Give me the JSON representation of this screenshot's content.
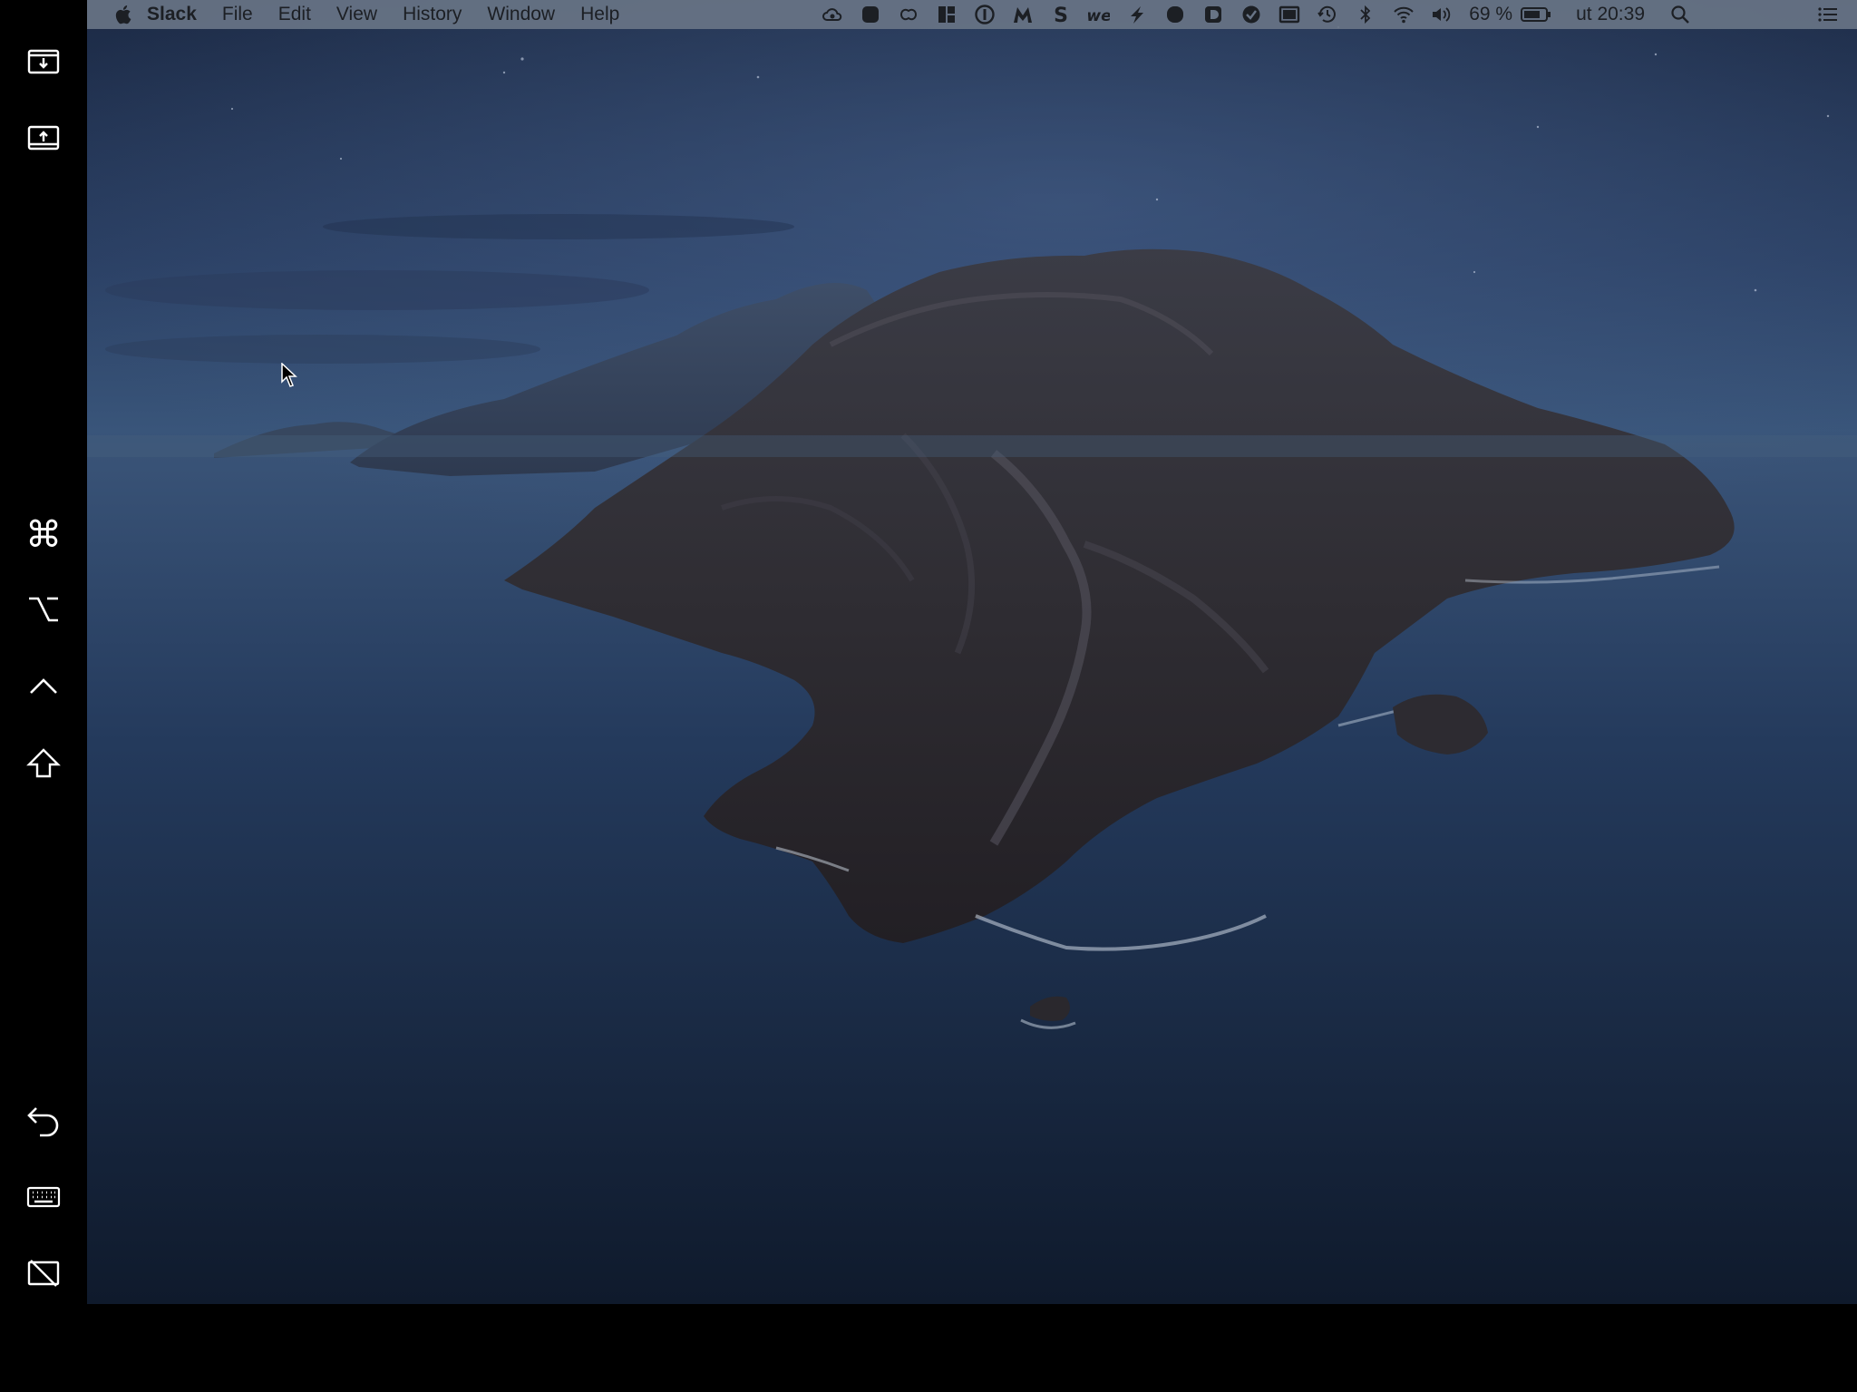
{
  "menubar": {
    "app_name": "Slack",
    "menus": [
      "File",
      "Edit",
      "View",
      "History",
      "Window",
      "Help"
    ],
    "battery": "69 %",
    "clock": "ut 20:39",
    "status_icons": [
      "creative-cloud-icon",
      "record-icon",
      "mindnode-icon",
      "magnet-icon",
      "1password-icon",
      "mailbutler-icon",
      "scrivener-icon",
      "wechat-icon",
      "spark-icon",
      "record-icon",
      "dropzone-icon",
      "things-icon",
      "display-icon",
      "time-machine-icon",
      "bluetooth-icon",
      "wifi-icon",
      "volume-icon"
    ]
  },
  "sidebar": {
    "buttons": [
      "show-menubar-icon",
      "show-dock-icon",
      "command-key-icon",
      "option-key-icon",
      "control-key-icon",
      "shift-key-icon",
      "undo-icon",
      "keyboard-icon",
      "disconnect-display-icon"
    ]
  },
  "colors": {
    "menubar_bg": "#687486",
    "sky": "#2a3f63",
    "ocean": "#1d2f4d",
    "island": "#2f2d33"
  }
}
